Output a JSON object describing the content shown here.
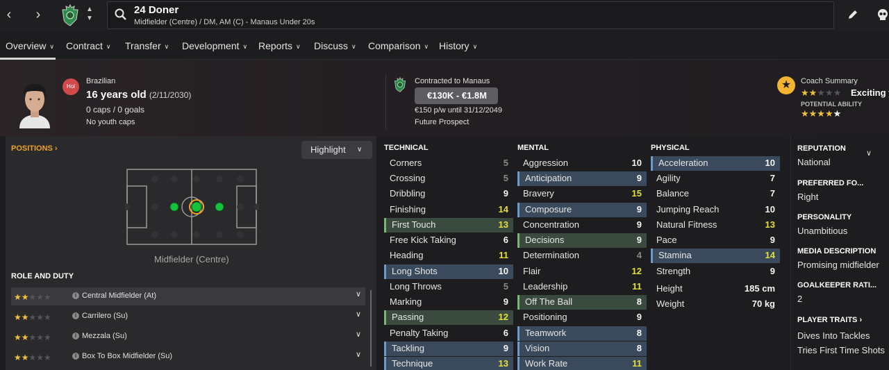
{
  "header": {
    "player_title": "24 Doner",
    "player_subtitle": "Midfielder (Centre) / DM, AM (C) - Manaus Under 20s"
  },
  "tabs": [
    {
      "label": "Overview"
    },
    {
      "label": "Contract"
    },
    {
      "label": "Transfer"
    },
    {
      "label": "Development"
    },
    {
      "label": "Reports"
    },
    {
      "label": "Discuss"
    },
    {
      "label": "Comparison"
    },
    {
      "label": "History"
    }
  ],
  "profile": {
    "nationality_badge": "Hol",
    "nationality": "Brazilian",
    "age": "16 years old",
    "dob": "(2/11/2030)",
    "caps_goals": "0 caps / 0 goals",
    "youth_caps": "No youth caps"
  },
  "contract": {
    "contracted_to": "Contracted to Manaus",
    "value_range": "€130K - €1.8M",
    "wage": "€150 p/w until 31/12/2049",
    "prospect": "Future Prospect"
  },
  "coach_summary": {
    "title": "Coach Summary",
    "current_stars": 2,
    "verdict": "Exciting y",
    "potential_label": "POTENTIAL ABILITY",
    "potential_stars": 4.5
  },
  "positions": {
    "title": "POSITIONS",
    "highlight_label": "Highlight",
    "position_label": "Midfielder (Centre)"
  },
  "roles": {
    "title": "ROLE AND DUTY",
    "items": [
      {
        "name": "Central Midfielder (At)",
        "stars": 2
      },
      {
        "name": "Carrilero (Su)",
        "stars": 2
      },
      {
        "name": "Mezzala (Su)",
        "stars": 2
      },
      {
        "name": "Box To Box Midfielder (Su)",
        "stars": 2
      }
    ]
  },
  "technical": {
    "title": "TECHNICAL",
    "items": [
      {
        "name": "Corners",
        "value": "5"
      },
      {
        "name": "Crossing",
        "value": "5"
      },
      {
        "name": "Dribbling",
        "value": "9"
      },
      {
        "name": "Finishing",
        "value": "14"
      },
      {
        "name": "First Touch",
        "value": "13"
      },
      {
        "name": "Free Kick Taking",
        "value": "6"
      },
      {
        "name": "Heading",
        "value": "11"
      },
      {
        "name": "Long Shots",
        "value": "10"
      },
      {
        "name": "Long Throws",
        "value": "5"
      },
      {
        "name": "Marking",
        "value": "9"
      },
      {
        "name": "Passing",
        "value": "12"
      },
      {
        "name": "Penalty Taking",
        "value": "6"
      },
      {
        "name": "Tackling",
        "value": "9"
      },
      {
        "name": "Technique",
        "value": "13"
      }
    ]
  },
  "mental": {
    "title": "MENTAL",
    "items": [
      {
        "name": "Aggression",
        "value": "10"
      },
      {
        "name": "Anticipation",
        "value": "9"
      },
      {
        "name": "Bravery",
        "value": "15"
      },
      {
        "name": "Composure",
        "value": "9"
      },
      {
        "name": "Concentration",
        "value": "9"
      },
      {
        "name": "Decisions",
        "value": "9"
      },
      {
        "name": "Determination",
        "value": "4"
      },
      {
        "name": "Flair",
        "value": "12"
      },
      {
        "name": "Leadership",
        "value": "11"
      },
      {
        "name": "Off The Ball",
        "value": "8"
      },
      {
        "name": "Positioning",
        "value": "9"
      },
      {
        "name": "Teamwork",
        "value": "8"
      },
      {
        "name": "Vision",
        "value": "8"
      },
      {
        "name": "Work Rate",
        "value": "11"
      }
    ]
  },
  "physical": {
    "title": "PHYSICAL",
    "items": [
      {
        "name": "Acceleration",
        "value": "10"
      },
      {
        "name": "Agility",
        "value": "7"
      },
      {
        "name": "Balance",
        "value": "7"
      },
      {
        "name": "Jumping Reach",
        "value": "10"
      },
      {
        "name": "Natural Fitness",
        "value": "13"
      },
      {
        "name": "Pace",
        "value": "9"
      },
      {
        "name": "Stamina",
        "value": "14"
      },
      {
        "name": "Strength",
        "value": "9"
      }
    ],
    "height_label": "Height",
    "height_value": "185 cm",
    "weight_label": "Weight",
    "weight_value": "70 kg"
  },
  "right_panel": {
    "reputation_title": "REPUTATION",
    "reputation_value": "National",
    "preferred_foot_title": "PREFERRED FO...",
    "preferred_foot_value": "Right",
    "personality_title": "PERSONALITY",
    "personality_value": "Unambitious",
    "media_title": "MEDIA DESCRIPTION",
    "media_value": "Promising midfielder",
    "gk_title": "GOALKEEPER RATI...",
    "gk_value": "2",
    "traits_title": "PLAYER TRAITS",
    "traits": [
      "Dives Into Tackles",
      "Tries First Time Shots"
    ]
  }
}
